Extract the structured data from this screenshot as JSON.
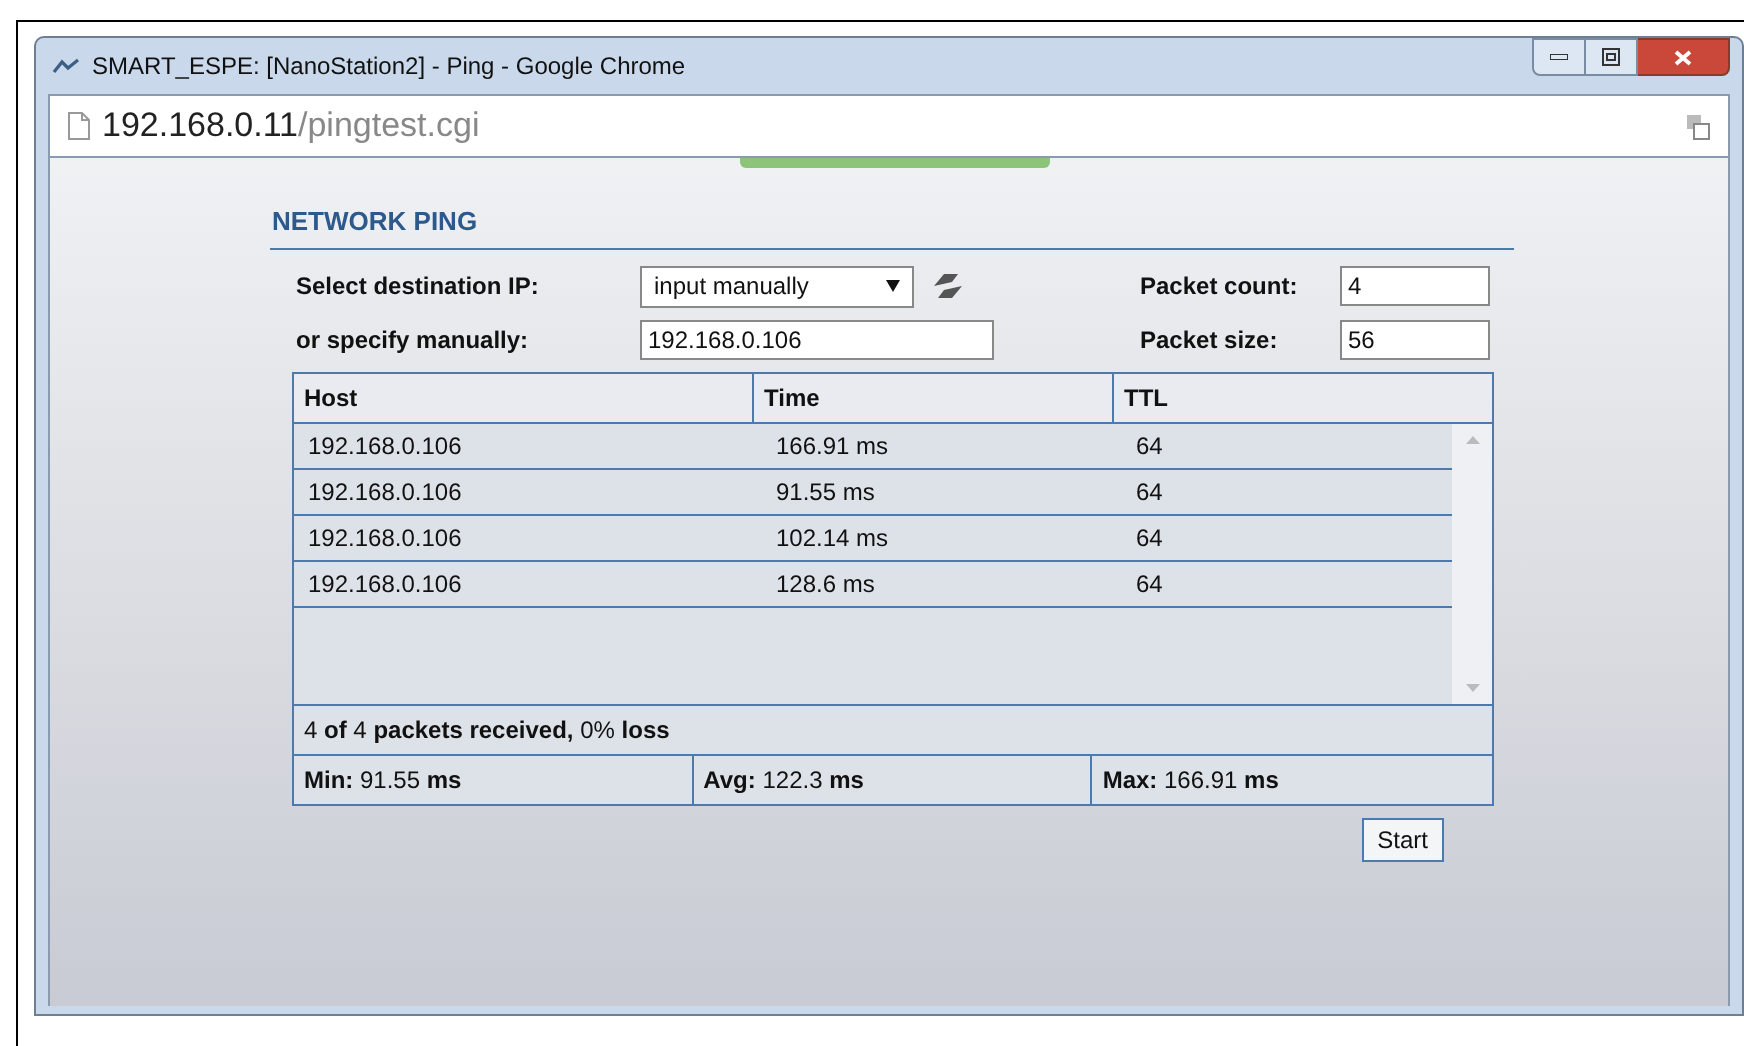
{
  "window": {
    "title": "SMART_ESPE: [NanoStation2] - Ping - Google Chrome"
  },
  "address_bar": {
    "host": "192.168.0.11",
    "path": "/pingtest.cgi"
  },
  "section_title": "NETWORK PING",
  "form": {
    "destination_label": "Select destination IP:",
    "destination_value": "input manually",
    "manual_label": "or specify manually:",
    "manual_value": "192.168.0.106",
    "count_label": "Packet count:",
    "count_value": "4",
    "size_label": "Packet size:",
    "size_value": "56"
  },
  "table": {
    "columns": [
      "Host",
      "Time",
      "TTL"
    ],
    "rows": [
      [
        "192.168.0.106",
        "166.91 ms",
        "64"
      ],
      [
        "192.168.0.106",
        "91.55 ms",
        "64"
      ],
      [
        "192.168.0.106",
        "102.14 ms",
        "64"
      ],
      [
        "192.168.0.106",
        "128.6 ms",
        "64"
      ]
    ]
  },
  "summary": "4 **of** 4 **packets received,** 0% **loss**",
  "stats": [
    "**Min:** 91.55 **ms**",
    "**Avg:** 122.3 **ms**",
    "**Max:** 166.91 **ms**"
  ],
  "start_button": "Start"
}
